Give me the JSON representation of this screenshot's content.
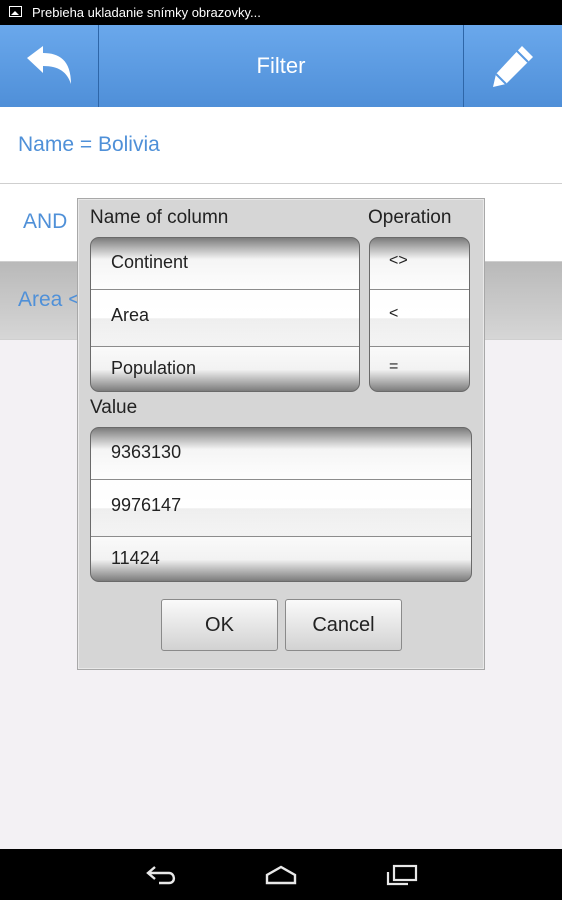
{
  "status_bar": {
    "icon": "screenshot-icon",
    "text": "Prebieha ukladanie snímky obrazovky..."
  },
  "action_bar": {
    "title": "Filter",
    "back_icon": "back-arrow-icon",
    "edit_icon": "pencil-icon",
    "color": "#5a9ae2"
  },
  "conditions": [
    {
      "text": "Name = Bolivia"
    },
    {
      "text": "AND"
    },
    {
      "text": "Area <"
    }
  ],
  "dialog": {
    "column_label": "Name of column",
    "operation_label": "Operation",
    "value_label": "Value",
    "columns": [
      "Continent",
      "Area",
      "Population"
    ],
    "selected_column": "Area",
    "operations": [
      "<>",
      "<",
      "="
    ],
    "selected_operation": "<",
    "values": [
      "9363130",
      "9976147",
      "11424"
    ],
    "selected_value": "9976147",
    "ok_label": "OK",
    "cancel_label": "Cancel"
  },
  "nav_bar": {
    "back_icon": "nav-back-icon",
    "home_icon": "nav-home-icon",
    "recent_icon": "nav-recent-apps-icon"
  }
}
